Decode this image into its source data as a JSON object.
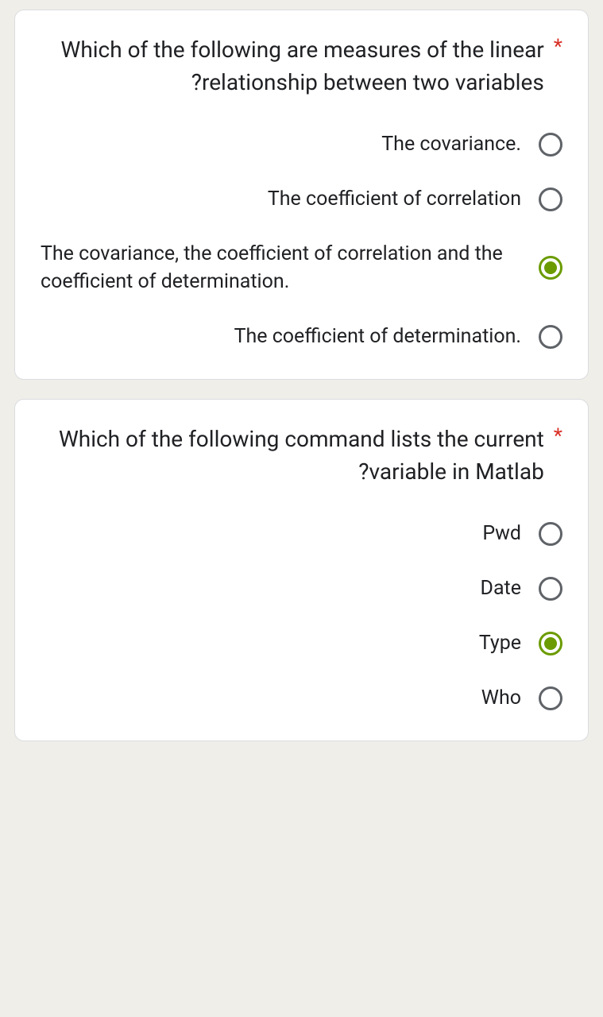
{
  "required_marker": "*",
  "questions": [
    {
      "text": "Which of the following are measures of the linear relationship between two variables?",
      "options": [
        {
          "label": "The covariance.",
          "selected": false,
          "align": "right"
        },
        {
          "label": "The coefficient of correlation",
          "selected": false,
          "align": "right"
        },
        {
          "label": "The covariance, the coefficient of correlation and the coefficient of determination.",
          "selected": true,
          "align": "left"
        },
        {
          "label": "The coefficient of determination.",
          "selected": false,
          "align": "right"
        }
      ]
    },
    {
      "text": "Which of the following command lists the current variable in Matlab?",
      "options": [
        {
          "label": "Pwd",
          "selected": false,
          "align": "right"
        },
        {
          "label": "Date",
          "selected": false,
          "align": "right"
        },
        {
          "label": "Type",
          "selected": true,
          "align": "right"
        },
        {
          "label": "Who",
          "selected": false,
          "align": "right"
        }
      ]
    }
  ]
}
